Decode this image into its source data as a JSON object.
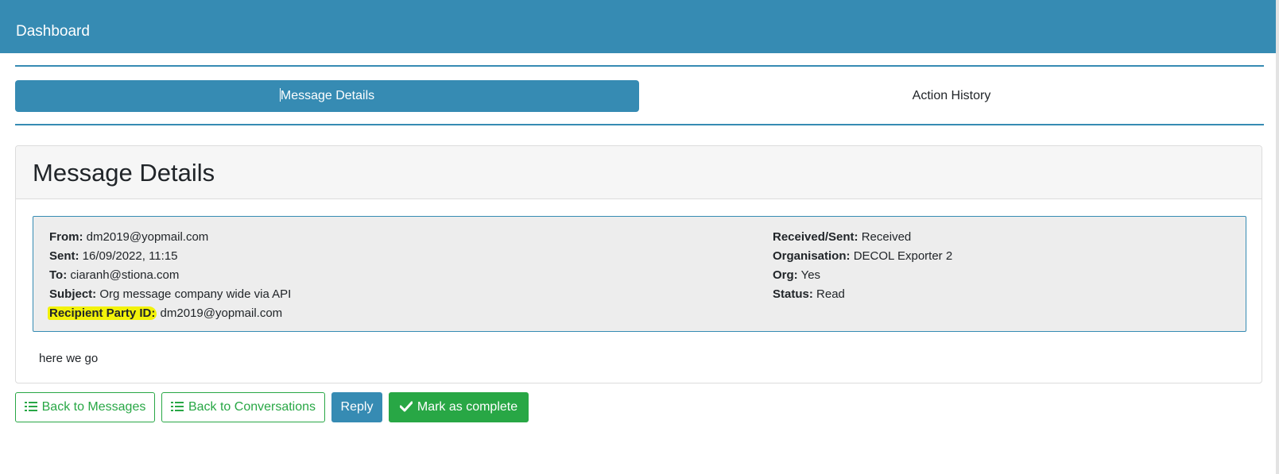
{
  "header": {
    "title": "Dashboard"
  },
  "tabs": [
    {
      "label": "Message Details",
      "active": true
    },
    {
      "label": "Action History",
      "active": false
    }
  ],
  "card": {
    "title": "Message Details"
  },
  "details": {
    "left": [
      {
        "label": "From:",
        "value": "dm2019@yopmail.com"
      },
      {
        "label": "Sent:",
        "value": "16/09/2022, 11:15"
      },
      {
        "label": "To:",
        "value": "ciaranh@stiona.com"
      },
      {
        "label": "Subject:",
        "value": "Org message company wide via API"
      },
      {
        "label": "Recipient Party ID:",
        "value": "dm2019@yopmail.com",
        "highlighted": true
      }
    ],
    "right": [
      {
        "label": "Received/Sent:",
        "value": "Received"
      },
      {
        "label": "Organisation:",
        "value": "DECOL Exporter 2"
      },
      {
        "label": "Org:",
        "value": "Yes"
      },
      {
        "label": "Status:",
        "value": "Read"
      }
    ]
  },
  "message_body": "here we go",
  "actions": {
    "back_to_messages": "Back to Messages",
    "back_to_conversations": "Back to Conversations",
    "reply": "Reply",
    "mark_complete": "Mark as complete"
  },
  "colors": {
    "primary": "#368bb3",
    "success": "#28a745",
    "highlight": "#f2f20a",
    "info_box_bg": "#ededed"
  },
  "icons": {
    "list": "list-icon",
    "check": "check-icon"
  }
}
